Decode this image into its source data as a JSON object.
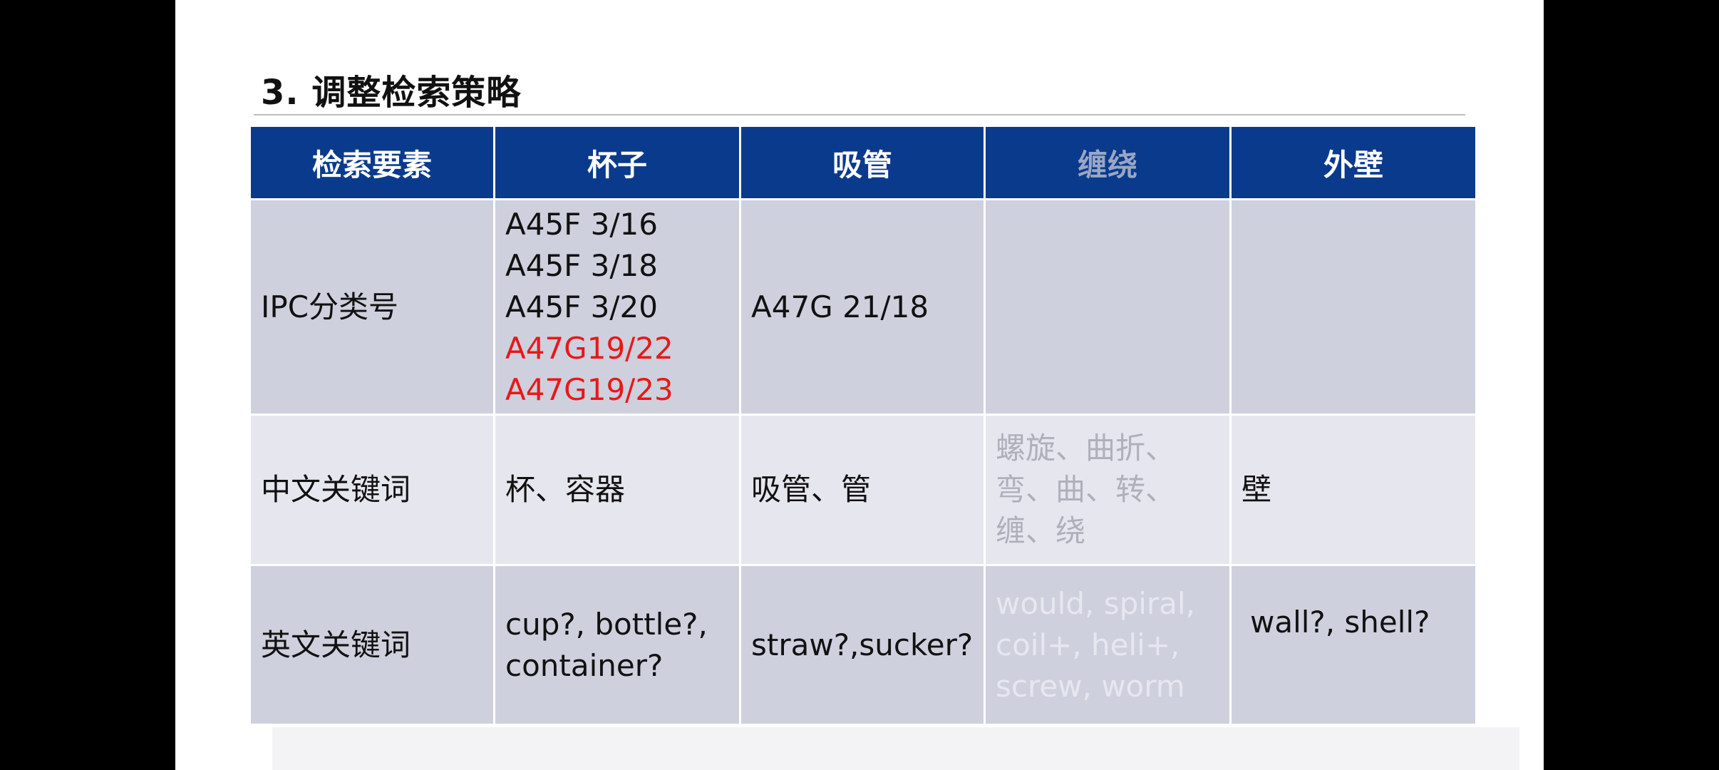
{
  "slide": {
    "title": "3. 调整检索策略"
  },
  "table": {
    "headers": [
      "检索要素",
      "杯子",
      "吸管",
      "缠绕",
      "外壁"
    ],
    "rows": [
      {
        "label": "IPC分类号",
        "cup": [
          "A45F 3/16",
          "A45F 3/18",
          "A45F 3/20"
        ],
        "cup_red": [
          "A47G19/22",
          "A47G19/23"
        ],
        "straw": "A47G 21/18",
        "wind": "",
        "wall": ""
      },
      {
        "label": "中文关键词",
        "cup": "杯、容器",
        "straw": "吸管、管",
        "wind": [
          "螺旋、曲折、",
          "弯、曲、转、",
          "缠、绕"
        ],
        "wall": "壁"
      },
      {
        "label": "英文关键词",
        "cup": [
          "cup?, bottle?,",
          "container?"
        ],
        "straw": "straw?,sucker?",
        "wind": [
          "would, spiral,",
          "coil+, heli+,",
          "screw, worm"
        ],
        "wall": "wall?, shell?"
      }
    ]
  },
  "colors": {
    "header_bg": "#0a3a8c",
    "row_dark": "#ced0dd",
    "row_light": "#e6e7ee",
    "highlight_red": "#e81818"
  }
}
